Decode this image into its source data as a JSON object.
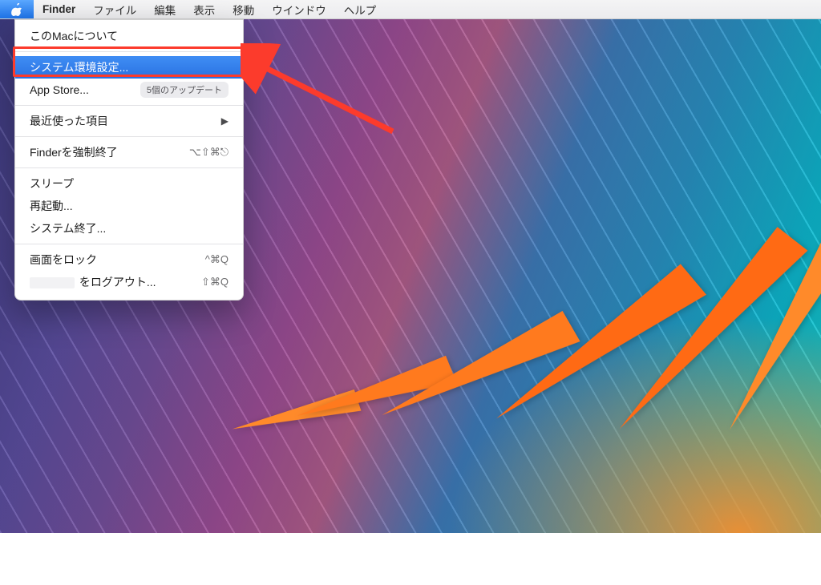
{
  "menubar": {
    "app_name": "Finder",
    "items": [
      "ファイル",
      "編集",
      "表示",
      "移動",
      "ウインドウ",
      "ヘルプ"
    ]
  },
  "apple_menu": {
    "about": "このMacについて",
    "system_preferences": "システム環境設定...",
    "app_store": {
      "label": "App Store...",
      "badge": "5個のアップデート"
    },
    "recent_items": {
      "label": "最近使った項目",
      "submenu_glyph": "▶"
    },
    "force_quit": {
      "label": "Finderを強制終了",
      "shortcut": "⌥⇧⌘⎋"
    },
    "sleep": "スリープ",
    "restart": "再起動...",
    "shutdown": "システム終了...",
    "lock_screen": {
      "label": "画面をロック",
      "shortcut": "^⌘Q"
    },
    "logout": {
      "label_suffix": " をログアウト...",
      "shortcut": "⇧⌘Q"
    }
  },
  "highlight_color": "#fc3b2c",
  "selection_color": "#2a72e2"
}
